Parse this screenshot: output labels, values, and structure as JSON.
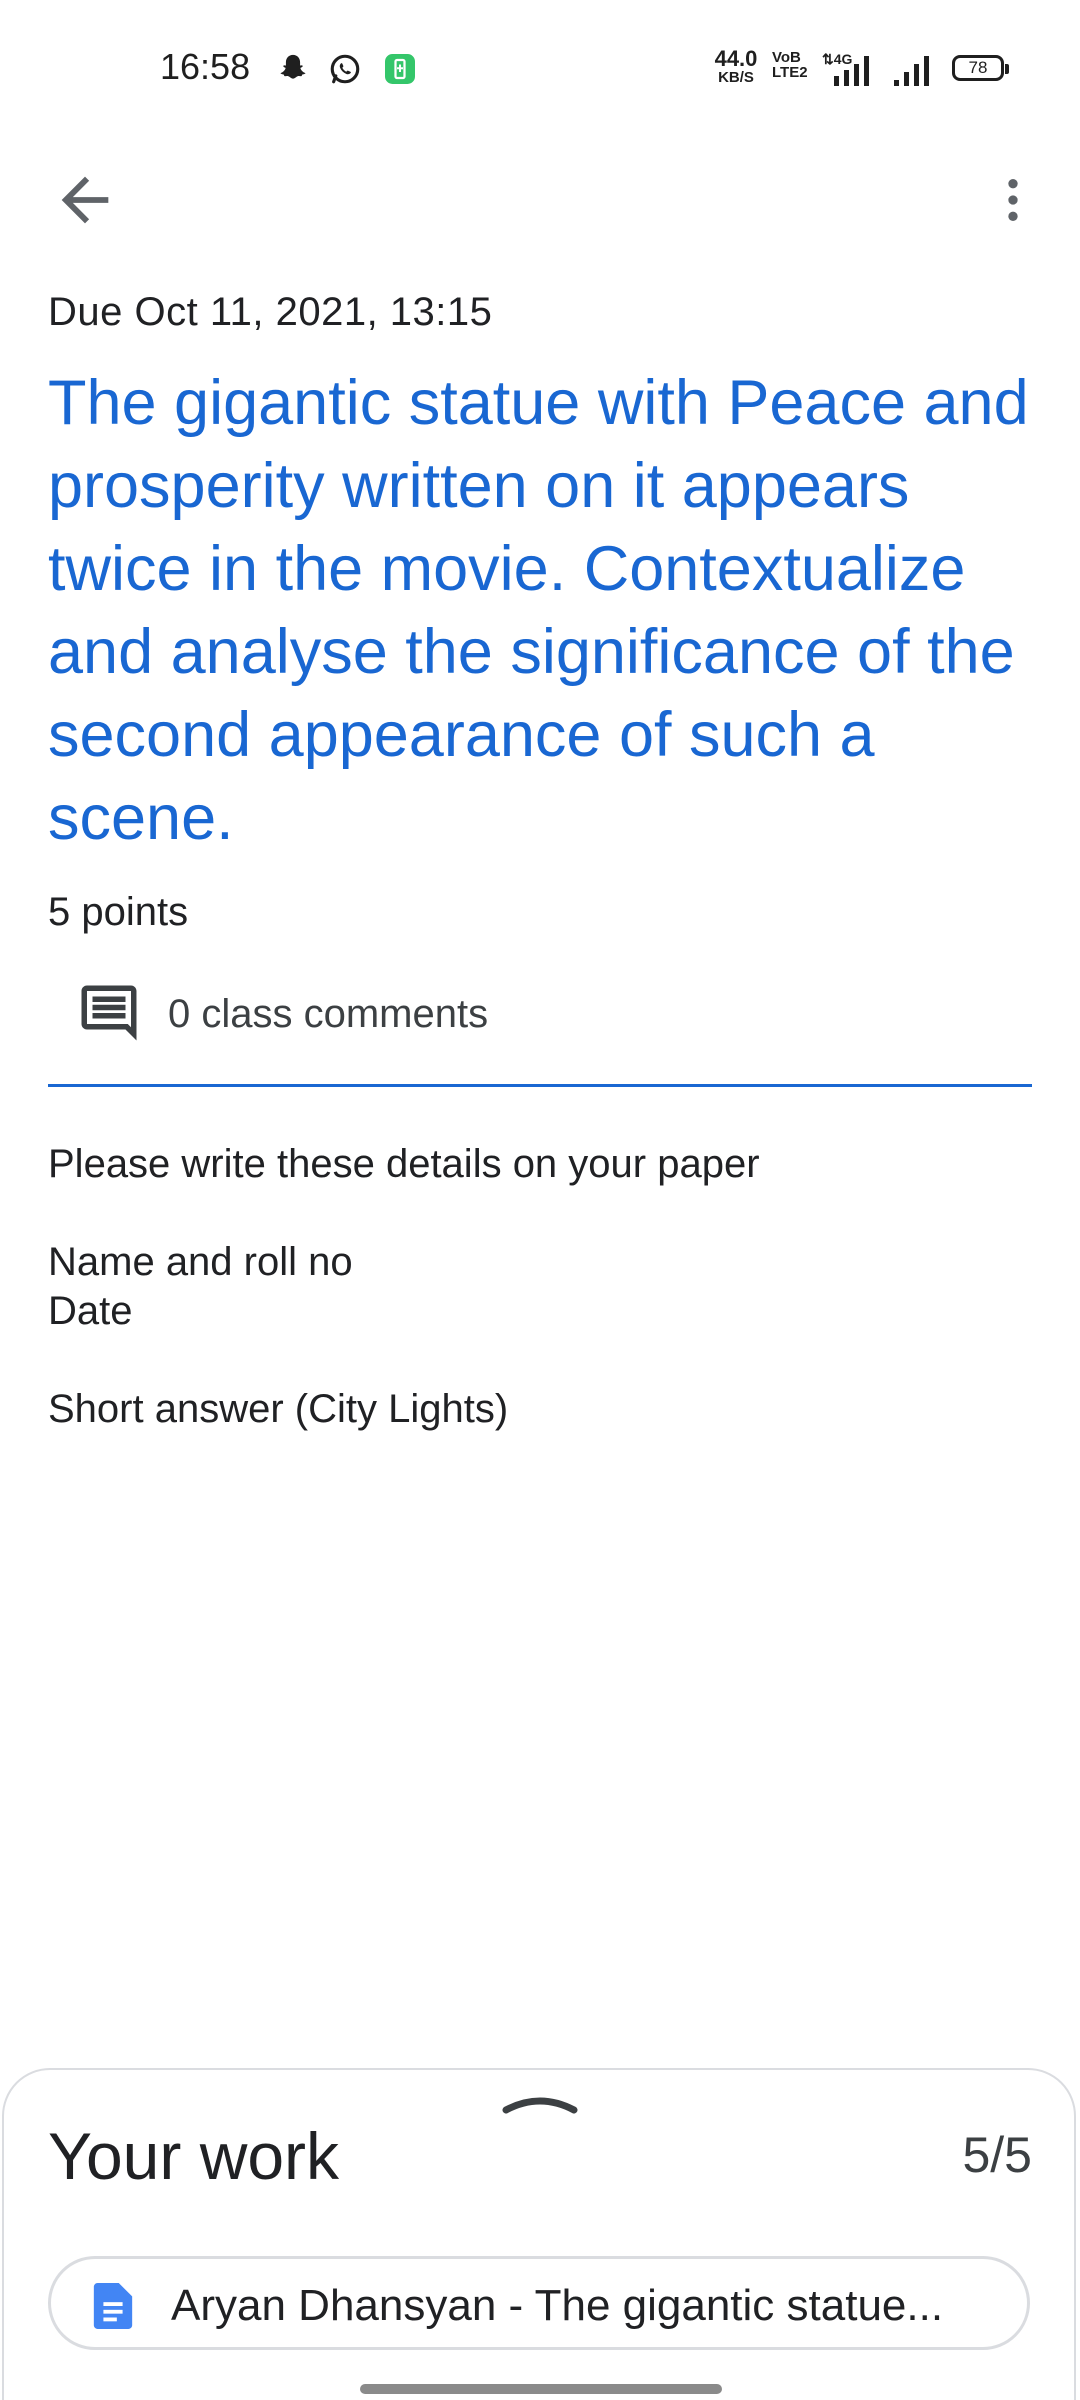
{
  "status_bar": {
    "time": "16:58",
    "net_speed_value": "44.0",
    "net_speed_unit": "KB/S",
    "volte_top": "VoB",
    "volte_bottom": "LTE2",
    "battery": "78",
    "icons": [
      "snapchat-icon",
      "whatsapp-icon",
      "battery-saver-icon",
      "4g-signal-icon",
      "signal-icon"
    ]
  },
  "toolbar": {
    "back_icon": "arrow-back-icon",
    "more_icon": "more-vert-icon"
  },
  "assignment": {
    "due": "Due Oct 11, 2021, 13:15",
    "title": "The gigantic statue with Peace and prosperity written on it appears twice in the movie. Contextualize and analyse the significance of the second appearance of such a scene.",
    "points": "5 points",
    "comments": "0 class comments",
    "description": {
      "line1": "Please write these details on your paper",
      "line2": "Name and roll no",
      "line3": "Date",
      "line4": "Short answer (City Lights)"
    }
  },
  "your_work": {
    "title": "Your work",
    "count": "5/5",
    "attachment": "Aryan Dhansyan - The gigantic statue..."
  },
  "colors": {
    "accent": "#1967d2",
    "doc_icon": "#4285f4"
  }
}
